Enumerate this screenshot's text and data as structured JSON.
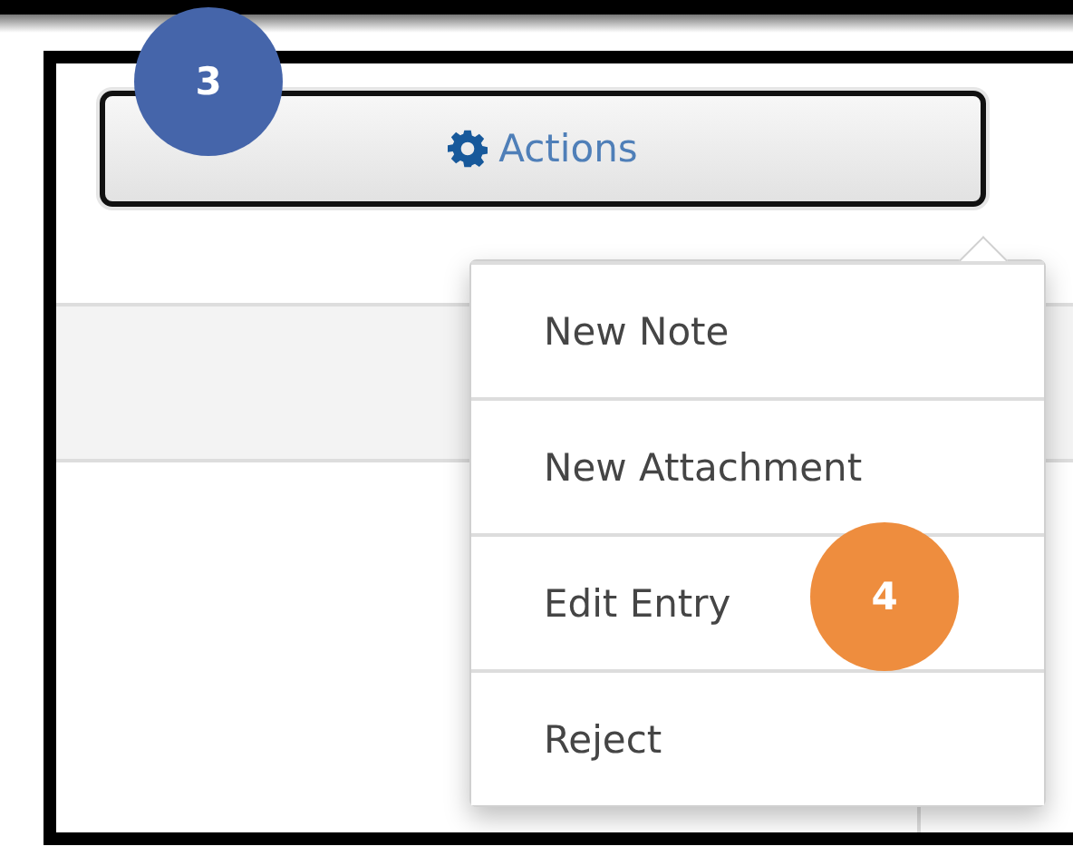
{
  "actions_button": {
    "label": "Actions"
  },
  "menu": {
    "items": [
      {
        "label": "New Note"
      },
      {
        "label": "New Attachment"
      },
      {
        "label": "Edit Entry"
      },
      {
        "label": "Reject"
      }
    ]
  },
  "badges": [
    {
      "label": "3",
      "color": "#4565aa"
    },
    {
      "label": "4",
      "color": "#ee8d3e"
    }
  ]
}
